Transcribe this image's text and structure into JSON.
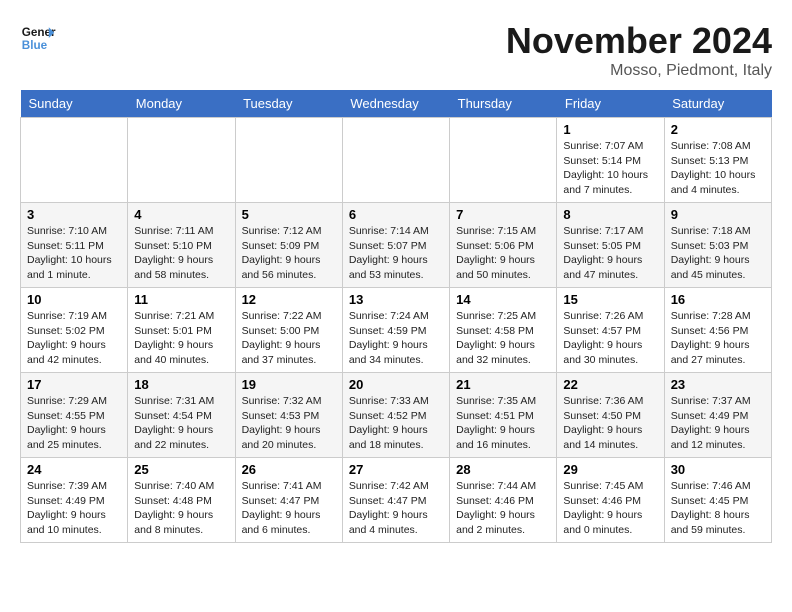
{
  "header": {
    "logo_text_general": "General",
    "logo_text_blue": "Blue",
    "month_title": "November 2024",
    "location": "Mosso, Piedmont, Italy"
  },
  "days_of_week": [
    "Sunday",
    "Monday",
    "Tuesday",
    "Wednesday",
    "Thursday",
    "Friday",
    "Saturday"
  ],
  "weeks": [
    [
      {
        "day": "",
        "info": ""
      },
      {
        "day": "",
        "info": ""
      },
      {
        "day": "",
        "info": ""
      },
      {
        "day": "",
        "info": ""
      },
      {
        "day": "",
        "info": ""
      },
      {
        "day": "1",
        "info": "Sunrise: 7:07 AM\nSunset: 5:14 PM\nDaylight: 10 hours and 7 minutes."
      },
      {
        "day": "2",
        "info": "Sunrise: 7:08 AM\nSunset: 5:13 PM\nDaylight: 10 hours and 4 minutes."
      }
    ],
    [
      {
        "day": "3",
        "info": "Sunrise: 7:10 AM\nSunset: 5:11 PM\nDaylight: 10 hours and 1 minute."
      },
      {
        "day": "4",
        "info": "Sunrise: 7:11 AM\nSunset: 5:10 PM\nDaylight: 9 hours and 58 minutes."
      },
      {
        "day": "5",
        "info": "Sunrise: 7:12 AM\nSunset: 5:09 PM\nDaylight: 9 hours and 56 minutes."
      },
      {
        "day": "6",
        "info": "Sunrise: 7:14 AM\nSunset: 5:07 PM\nDaylight: 9 hours and 53 minutes."
      },
      {
        "day": "7",
        "info": "Sunrise: 7:15 AM\nSunset: 5:06 PM\nDaylight: 9 hours and 50 minutes."
      },
      {
        "day": "8",
        "info": "Sunrise: 7:17 AM\nSunset: 5:05 PM\nDaylight: 9 hours and 47 minutes."
      },
      {
        "day": "9",
        "info": "Sunrise: 7:18 AM\nSunset: 5:03 PM\nDaylight: 9 hours and 45 minutes."
      }
    ],
    [
      {
        "day": "10",
        "info": "Sunrise: 7:19 AM\nSunset: 5:02 PM\nDaylight: 9 hours and 42 minutes."
      },
      {
        "day": "11",
        "info": "Sunrise: 7:21 AM\nSunset: 5:01 PM\nDaylight: 9 hours and 40 minutes."
      },
      {
        "day": "12",
        "info": "Sunrise: 7:22 AM\nSunset: 5:00 PM\nDaylight: 9 hours and 37 minutes."
      },
      {
        "day": "13",
        "info": "Sunrise: 7:24 AM\nSunset: 4:59 PM\nDaylight: 9 hours and 34 minutes."
      },
      {
        "day": "14",
        "info": "Sunrise: 7:25 AM\nSunset: 4:58 PM\nDaylight: 9 hours and 32 minutes."
      },
      {
        "day": "15",
        "info": "Sunrise: 7:26 AM\nSunset: 4:57 PM\nDaylight: 9 hours and 30 minutes."
      },
      {
        "day": "16",
        "info": "Sunrise: 7:28 AM\nSunset: 4:56 PM\nDaylight: 9 hours and 27 minutes."
      }
    ],
    [
      {
        "day": "17",
        "info": "Sunrise: 7:29 AM\nSunset: 4:55 PM\nDaylight: 9 hours and 25 minutes."
      },
      {
        "day": "18",
        "info": "Sunrise: 7:31 AM\nSunset: 4:54 PM\nDaylight: 9 hours and 22 minutes."
      },
      {
        "day": "19",
        "info": "Sunrise: 7:32 AM\nSunset: 4:53 PM\nDaylight: 9 hours and 20 minutes."
      },
      {
        "day": "20",
        "info": "Sunrise: 7:33 AM\nSunset: 4:52 PM\nDaylight: 9 hours and 18 minutes."
      },
      {
        "day": "21",
        "info": "Sunrise: 7:35 AM\nSunset: 4:51 PM\nDaylight: 9 hours and 16 minutes."
      },
      {
        "day": "22",
        "info": "Sunrise: 7:36 AM\nSunset: 4:50 PM\nDaylight: 9 hours and 14 minutes."
      },
      {
        "day": "23",
        "info": "Sunrise: 7:37 AM\nSunset: 4:49 PM\nDaylight: 9 hours and 12 minutes."
      }
    ],
    [
      {
        "day": "24",
        "info": "Sunrise: 7:39 AM\nSunset: 4:49 PM\nDaylight: 9 hours and 10 minutes."
      },
      {
        "day": "25",
        "info": "Sunrise: 7:40 AM\nSunset: 4:48 PM\nDaylight: 9 hours and 8 minutes."
      },
      {
        "day": "26",
        "info": "Sunrise: 7:41 AM\nSunset: 4:47 PM\nDaylight: 9 hours and 6 minutes."
      },
      {
        "day": "27",
        "info": "Sunrise: 7:42 AM\nSunset: 4:47 PM\nDaylight: 9 hours and 4 minutes."
      },
      {
        "day": "28",
        "info": "Sunrise: 7:44 AM\nSunset: 4:46 PM\nDaylight: 9 hours and 2 minutes."
      },
      {
        "day": "29",
        "info": "Sunrise: 7:45 AM\nSunset: 4:46 PM\nDaylight: 9 hours and 0 minutes."
      },
      {
        "day": "30",
        "info": "Sunrise: 7:46 AM\nSunset: 4:45 PM\nDaylight: 8 hours and 59 minutes."
      }
    ]
  ]
}
